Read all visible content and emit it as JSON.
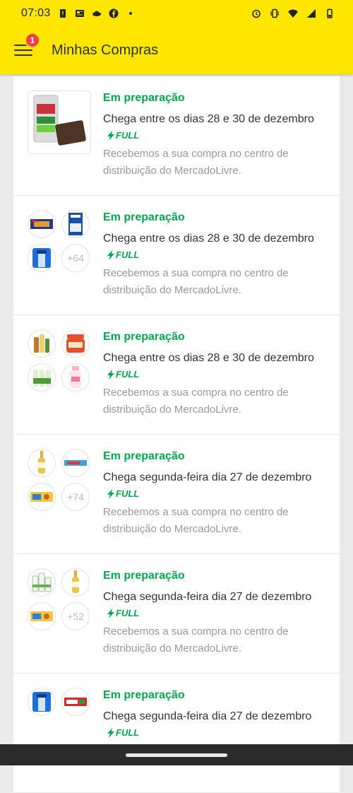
{
  "status_bar": {
    "time": "07:03"
  },
  "app_bar": {
    "title": "Minhas Compras",
    "notification_count": "1"
  },
  "colors": {
    "brand_yellow": "#ffe600",
    "status_green": "#00a650",
    "badge_red": "#f23d4f"
  },
  "orders": [
    {
      "status": "Em preparação",
      "eta": "Chega entre os dias 28 e 30 de dezembro",
      "shipping": "FULL",
      "description": "Recebemos a sua compra no centro de distribuição do MercadoLivre.",
      "thumbnails": [
        "sponge-pack"
      ]
    },
    {
      "status": "Em preparação",
      "eta": "Chega entre os dias 28 e 30 de dezembro",
      "shipping": "FULL",
      "description": "Recebemos a sua compra no centro de distribuição do MercadoLivre.",
      "thumbnails": [
        "cracker-box",
        "napkin-pack",
        "razor-pack"
      ],
      "more_count": "+64"
    },
    {
      "status": "Em preparação",
      "eta": "Chega entre os dias 28 e 30 de dezembro",
      "shipping": "FULL",
      "description": "Recebemos a sua compra no centro de distribuição do MercadoLivre.",
      "thumbnails": [
        "condiment-bottles",
        "jam-jar",
        "green-bottles",
        "lotion-bottle"
      ]
    },
    {
      "status": "Em preparação",
      "eta": "Chega segunda-feira dia 27 de dezembro",
      "shipping": "FULL",
      "description": "Recebemos a sua compra no centro de distribuição do MercadoLivre.",
      "thumbnails": [
        "beer-bottle",
        "wafer-bar",
        "biscuit-pack"
      ],
      "more_count": "+74"
    },
    {
      "status": "Em preparação",
      "eta": "Chega segunda-feira dia 27 de dezembro",
      "shipping": "FULL",
      "description": "Recebemos a sua compra no centro de distribuição do MercadoLivre.",
      "thumbnails": [
        "cream-bottles",
        "beer-bottle",
        "biscuit-pack"
      ],
      "more_count": "+52"
    },
    {
      "status": "Em preparação",
      "eta": "Chega segunda-feira dia 27 de dezembro",
      "shipping": "FULL",
      "thumbnails": [
        "razor-pack",
        "toothpaste-box"
      ]
    }
  ]
}
